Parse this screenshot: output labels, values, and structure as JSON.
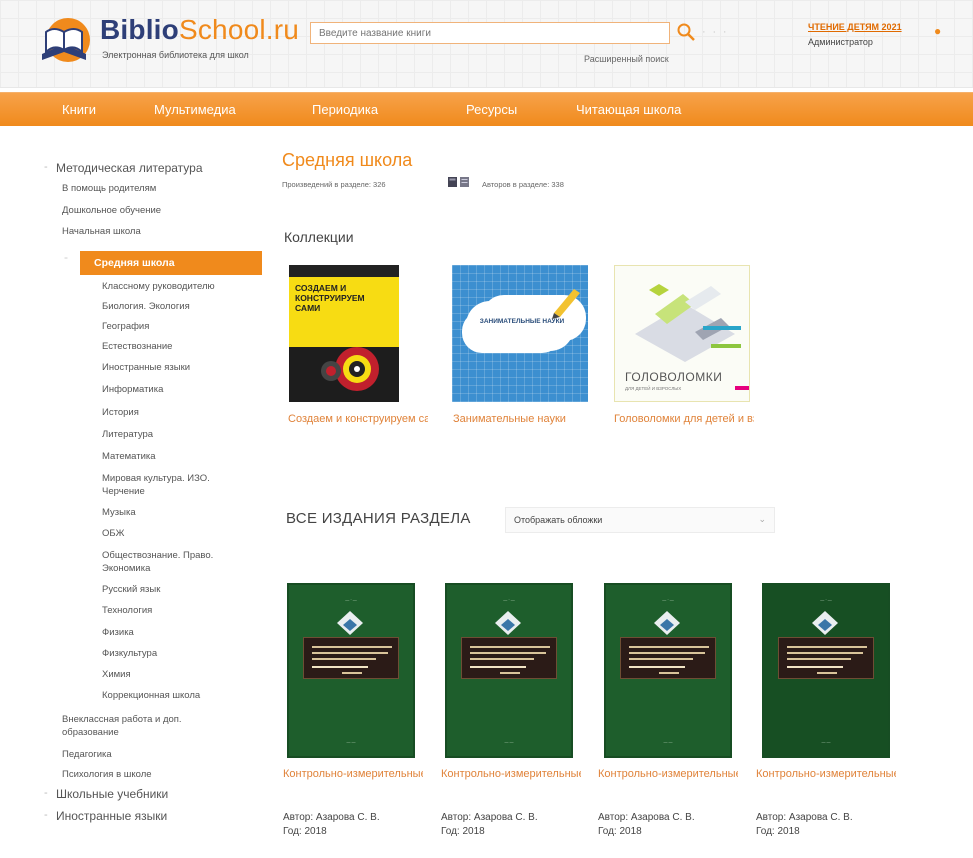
{
  "header": {
    "logo_part1": "Biblio",
    "logo_part2": "School.ru",
    "logo_subtitle": "Электронная библиотека для школ",
    "search_placeholder": "Введите название книги",
    "advanced_search": "Расширенный поиск",
    "promo_link": "ЧТЕНИЕ ДЕТЯМ 2021",
    "user_role": "Администратор",
    "colors": {
      "accent": "#f08a1c",
      "brand_dark": "#2e3f78"
    }
  },
  "nav": {
    "items": [
      "Книги",
      "Мультимедиа",
      "Периодика",
      "Ресурсы",
      "Читающая школа"
    ]
  },
  "sidebar": {
    "top_section": "Методическая литература",
    "level1_items": [
      "В помощь родителям",
      "Дошкольное обучение",
      "Начальная школа"
    ],
    "active_item": "Средняя школа",
    "subitems": [
      "Классному руководителю",
      "Биология. Экология",
      "География",
      "Естествознание",
      "Иностранные языки",
      "Информатика",
      "История",
      "Литература",
      "Математика",
      "Мировая культура. ИЗО.",
      "Черчение",
      "Музыка",
      "ОБЖ",
      "Обществознание. Право.",
      "Экономика",
      "Русский язык",
      "Технология",
      "Физика",
      "Физкультура",
      "Химия",
      "Коррекционная школа"
    ],
    "bottom_items": [
      "Внеклассная работа и доп.",
      "образование",
      "Педагогика",
      "Психология в школе"
    ],
    "sections": [
      "Школьные учебники",
      "Иностранные языки"
    ]
  },
  "main": {
    "page_title": "Средняя школа",
    "stats_left": "Произведений в разделе: 326",
    "stats_right": "Авторов в разделе: 338",
    "collections_title": "Коллекции",
    "collections": [
      {
        "caption": "Создаем и конструируем сами",
        "cover_text": "СОЗДАЕМ И КОНСТРУИРУЕМ САМИ"
      },
      {
        "caption": "Занимательные науки",
        "cover_text": "ЗАНИМАТЕЛЬНЫЕ НАУКИ"
      },
      {
        "caption": "Головоломки для детей и взрослых",
        "cover_text": "ГОЛОВОЛОМКИ",
        "cover_subtext": "ДЛЯ ДЕТЕЙ И ВЗРОСЛЫХ"
      }
    ],
    "all_title": "ВСЕ ИЗДАНИЯ РАЗДЕЛА",
    "display_select": "Отображать обложки",
    "books": [
      {
        "title": "Контрольно-измерительные материалы",
        "author": "Автор: Азарова С. В.",
        "year": "Год: 2018"
      },
      {
        "title": "Контрольно-измерительные материалы",
        "author": "Автор: Азарова С. В.",
        "year": "Год: 2018"
      },
      {
        "title": "Контрольно-измерительные материалы",
        "author": "Автор: Азарова С. В.",
        "year": "Год: 2018"
      },
      {
        "title": "Контрольно-измерительные материалы",
        "author": "Автор: Азарова С. В.",
        "year": "Год: 2018"
      }
    ]
  }
}
